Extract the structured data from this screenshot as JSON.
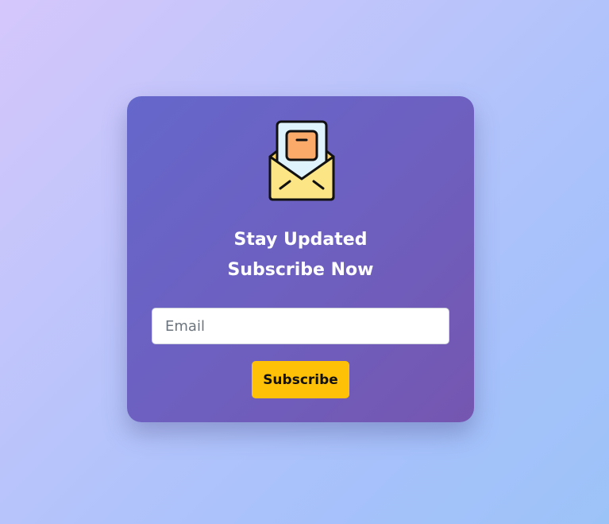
{
  "card": {
    "icon": "open-envelope-letter-icon",
    "title_line1": "Stay Updated",
    "title_line2": "Subscribe Now",
    "email_placeholder": "Email",
    "email_value": "",
    "subscribe_label": "Subscribe"
  },
  "colors": {
    "card_gradient_start": "#6567cb",
    "card_gradient_end": "#7556b0",
    "button_bg": "#ffc107",
    "title_text": "#ffffff"
  }
}
